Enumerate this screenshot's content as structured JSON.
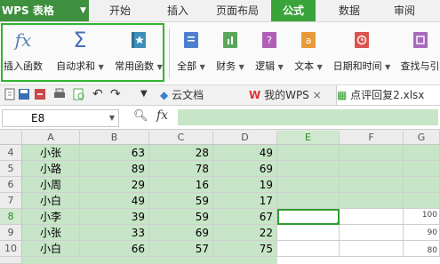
{
  "app": {
    "name": "WPS 表格"
  },
  "ribbon_tabs": [
    "开始",
    "插入",
    "页面布局",
    "公式",
    "数据",
    "审阅"
  ],
  "active_tab": "公式",
  "ribbon_buttons": {
    "insert_function": "插入函数",
    "autosum": "自动求和",
    "common_functions": "常用函数",
    "all": "全部",
    "finance": "财务",
    "logic": "逻辑",
    "text": "文本",
    "datetime": "日期和时间",
    "lookup": "查找与引"
  },
  "doc_tabs": {
    "cloud": "云文档",
    "mywps": "我的WPS",
    "file": "点评回复2.xlsx"
  },
  "formula_bar": {
    "cell_ref": "E8",
    "fx": "fx"
  },
  "columns": [
    "A",
    "B",
    "C",
    "D",
    "E",
    "F",
    "G"
  ],
  "rows": [
    {
      "num": "4",
      "name": "小张",
      "b": "63",
      "c": "28",
      "d": "49"
    },
    {
      "num": "5",
      "name": "小路",
      "b": "89",
      "c": "78",
      "d": "69"
    },
    {
      "num": "6",
      "name": "小周",
      "b": "29",
      "c": "16",
      "d": "19"
    },
    {
      "num": "7",
      "name": "小白",
      "b": "49",
      "c": "59",
      "d": "17"
    },
    {
      "num": "8",
      "name": "小李",
      "b": "39",
      "c": "59",
      "d": "67"
    },
    {
      "num": "9",
      "name": "小张",
      "b": "33",
      "c": "69",
      "d": "22"
    },
    {
      "num": "10",
      "name": "小白",
      "b": "66",
      "c": "57",
      "d": "75"
    }
  ],
  "chart_axis_labels": [
    "100",
    "90",
    "80"
  ],
  "colors": {
    "accent": "#3aa43a",
    "highlight_box": "#2fb52f",
    "cell_fill": "#c7e5c7"
  }
}
